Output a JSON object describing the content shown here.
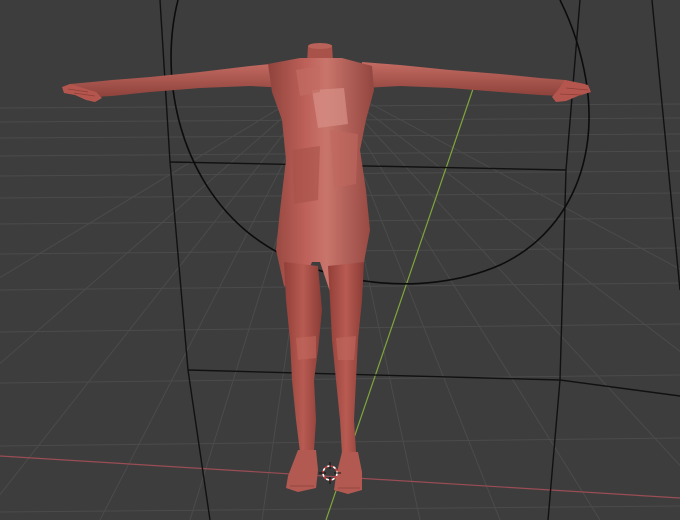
{
  "viewport": {
    "background_color": "#3d3d3d",
    "grid_color": "#4a4a4a",
    "grid_major_color": "#565656",
    "x_axis_color": "#9a4d55",
    "y_axis_color": "#7fa63c",
    "bound_box_color": "#0d0d0d"
  },
  "model": {
    "skin_color": "#b4574f",
    "skin_light_color": "#d1877f",
    "skin_dark_color": "#8a3f38",
    "pose": "T-pose",
    "headless": true
  },
  "icons": {
    "cursor": "3d-cursor-icon"
  }
}
